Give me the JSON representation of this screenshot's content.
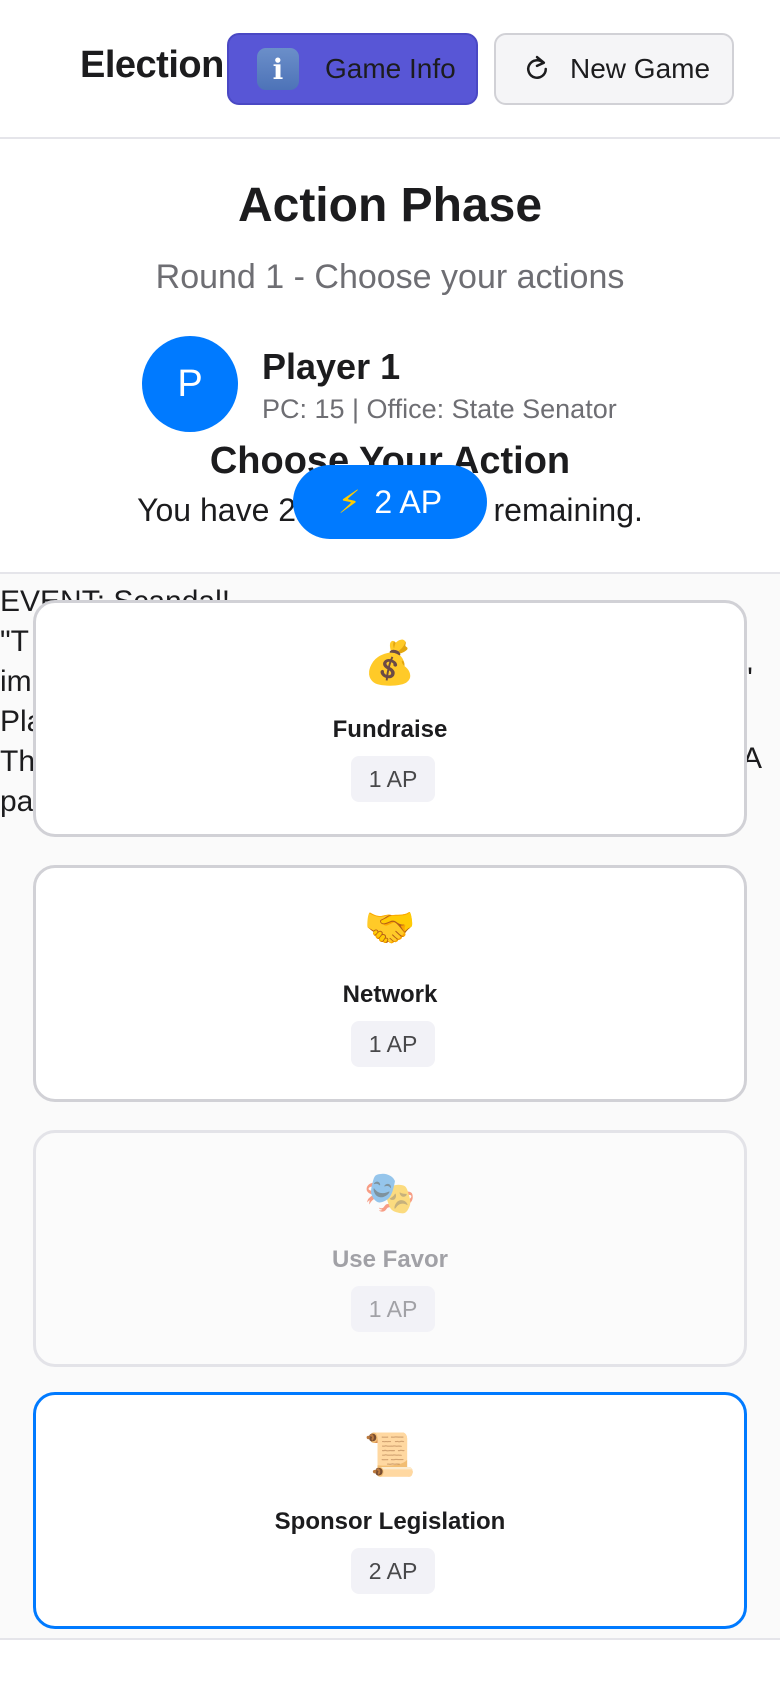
{
  "header": {
    "title": "Election",
    "game_info_label": "Game Info",
    "new_game_label": "New Game"
  },
  "phase": {
    "title": "Action Phase",
    "subtitle": "Round 1 - Choose your actions"
  },
  "player": {
    "avatar_initial": "P",
    "name": "Player 1",
    "meta": "PC: 15 | Office: State Senator"
  },
  "action_prompt": {
    "title": "Choose Your Action",
    "remaining": "You have 2 action points remaining.",
    "ap_badge": "2 AP"
  },
  "event_lines": [
    "EVENT: Scandal!",
    "\"T",
    "im",
    "Pla",
    "Th",
    "pa"
  ],
  "event_right_fragments": [
    "\"",
    "A"
  ],
  "actions": [
    {
      "emoji": "💰",
      "name": "Fundraise",
      "cost": "1 AP",
      "state": "normal"
    },
    {
      "emoji": "🤝",
      "name": "Network",
      "cost": "1 AP",
      "state": "normal"
    },
    {
      "emoji": "🎭",
      "name": "Use Favor",
      "cost": "1 AP",
      "state": "disabled"
    },
    {
      "emoji": "📜",
      "name": "Sponsor Legislation",
      "cost": "2 AP",
      "state": "selected"
    }
  ],
  "colors": {
    "accent": "#007aff",
    "info_button": "#5856d6",
    "bolt": "#ffcc00"
  }
}
